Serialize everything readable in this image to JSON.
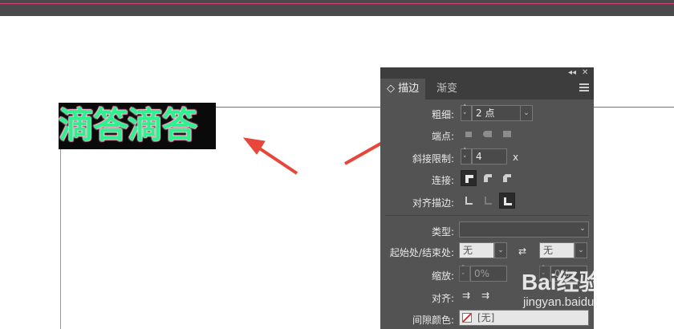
{
  "canvas": {
    "art_text": "滴答滴答"
  },
  "panel": {
    "tabs": [
      {
        "label": "◇ 描边"
      },
      {
        "label": "渐变"
      }
    ],
    "weight": {
      "label": "粗细:",
      "value": "2 点"
    },
    "cap": {
      "label": "端点:"
    },
    "miter": {
      "label": "斜接限制:",
      "value": "4",
      "suffix": "x"
    },
    "join": {
      "label": "连接:"
    },
    "align": {
      "label": "对齐描边:"
    },
    "type": {
      "label": "类型:"
    },
    "start_end": {
      "label": "起始处/结束处:",
      "start": "无",
      "end": "无"
    },
    "scale": {
      "label": "缩放:",
      "start": "0%",
      "end": "0%"
    },
    "align2": {
      "label": "对齐:"
    },
    "gap_color": {
      "label": "间隙颜色:",
      "value": "[无]"
    }
  },
  "watermark": {
    "brand": "Bai经验",
    "url": "jingyan.baidu.com"
  },
  "colors": {
    "accent_arrow": "#e8463a",
    "text_fill": "#2ef08f",
    "guide": "#d8407a"
  }
}
